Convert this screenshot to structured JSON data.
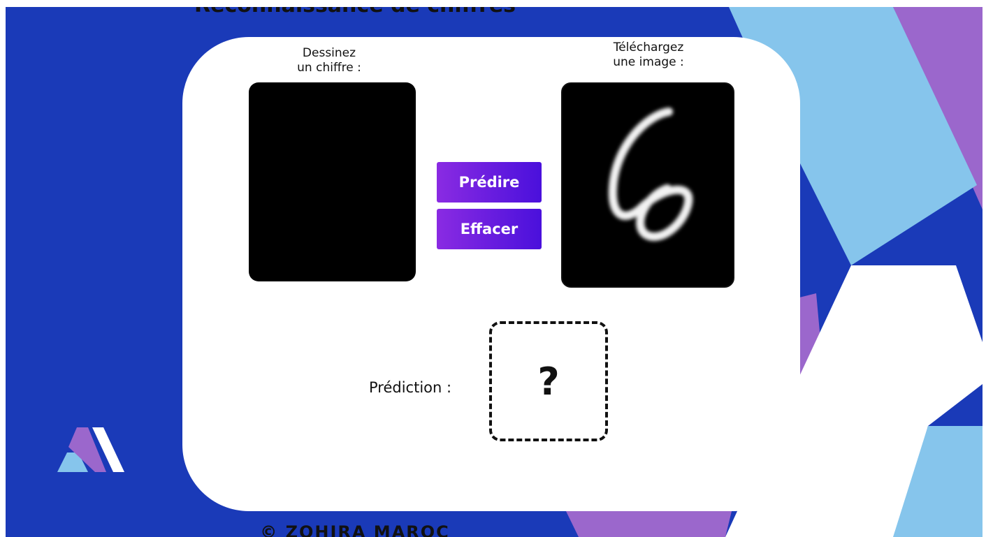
{
  "app": {
    "title": "Reconnaissance de chiffres",
    "footer": "© ZOHIRA MAROC"
  },
  "draw": {
    "label": "Dessinez\nun chiffre :"
  },
  "upload": {
    "label": "Téléchargez\nune image :",
    "preview_digit_icon": "handwritten-digit-6"
  },
  "actions": {
    "predict_label": "Prédire",
    "clear_label": "Effacer"
  },
  "prediction": {
    "label": "Prédiction :",
    "value": "?"
  },
  "colors": {
    "background": "#1a3ab8",
    "card": "#ffffff",
    "button_start": "#8a2be2",
    "button_end": "#4a10dc",
    "light_blue": "#86c5ec",
    "purple": "#9b67cc"
  }
}
